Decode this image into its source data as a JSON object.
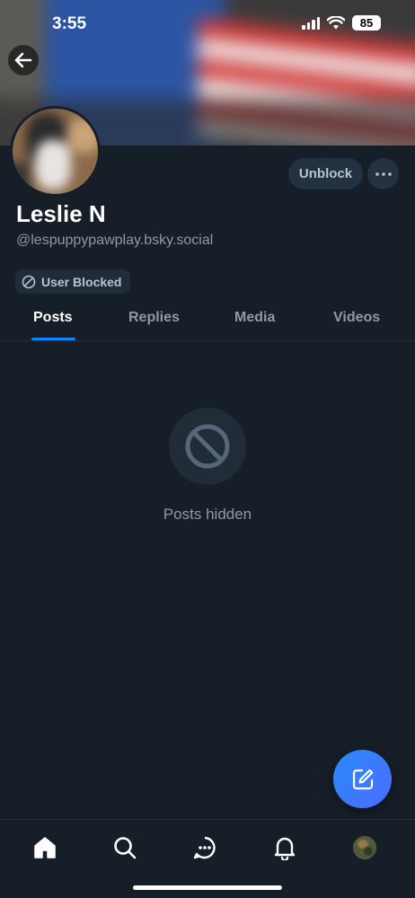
{
  "status_bar": {
    "time": "3:55",
    "battery": "85"
  },
  "profile": {
    "display_name": "Leslie N",
    "handle": "@lespuppypawplay.bsky.social",
    "blocked_badge": "User Blocked"
  },
  "actions": {
    "unblock_label": "Unblock"
  },
  "tabs": [
    {
      "label": "Posts",
      "active": true
    },
    {
      "label": "Replies",
      "active": false
    },
    {
      "label": "Media",
      "active": false
    },
    {
      "label": "Videos",
      "active": false
    }
  ],
  "empty_state": {
    "message": "Posts hidden",
    "icon": "ban-icon"
  },
  "bottom_nav": [
    {
      "icon": "home-icon",
      "active": true
    },
    {
      "icon": "search-icon",
      "active": false
    },
    {
      "icon": "chat-icon",
      "active": false
    },
    {
      "icon": "bell-icon",
      "active": false
    },
    {
      "icon": "profile-avatar",
      "active": false
    }
  ],
  "colors": {
    "background": "#161e27",
    "surface": "#212c39",
    "button": "#243140",
    "muted_text": "#8d9aa9",
    "accent": "#1083fe",
    "fab": "#3d7bff"
  }
}
